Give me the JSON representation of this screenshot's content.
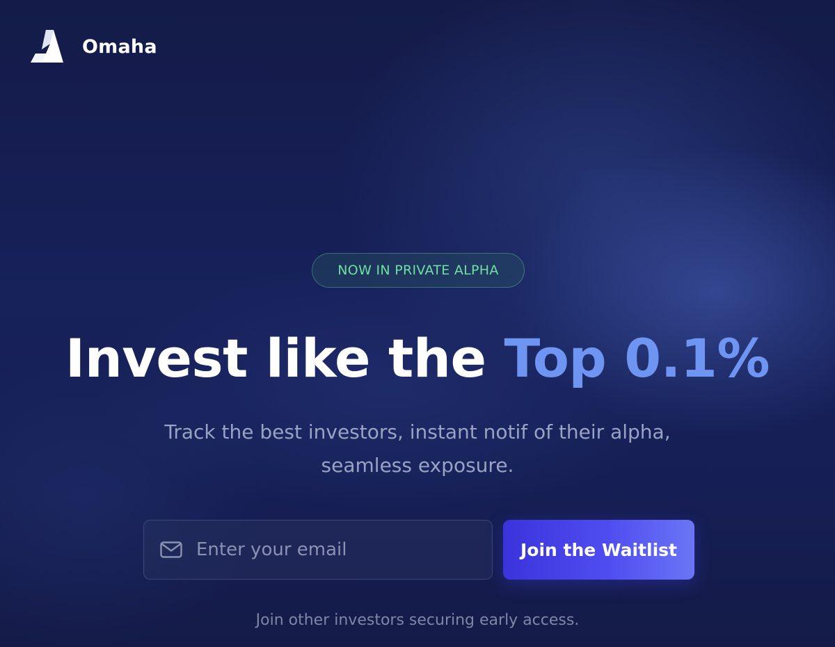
{
  "brand": {
    "name": "Omaha",
    "icon": "omaha-logo-icon"
  },
  "hero": {
    "badge": "NOW IN PRIVATE ALPHA",
    "headline_plain": "Invest like the ",
    "headline_accent": "Top 0.1%",
    "subtitle": "Track the best investors, instant notif of their alpha, seamless exposure."
  },
  "signup": {
    "email_icon": "mail-icon",
    "email_placeholder": "Enter your email",
    "email_value": "",
    "button_label": "Join the Waitlist",
    "footnote": "Join other investors securing early access."
  },
  "colors": {
    "background": "#141b48",
    "accent_text": "#6f95f3",
    "badge_text": "#6fe0a4",
    "button_start": "#3b33dc",
    "button_end": "#6a76f5"
  }
}
